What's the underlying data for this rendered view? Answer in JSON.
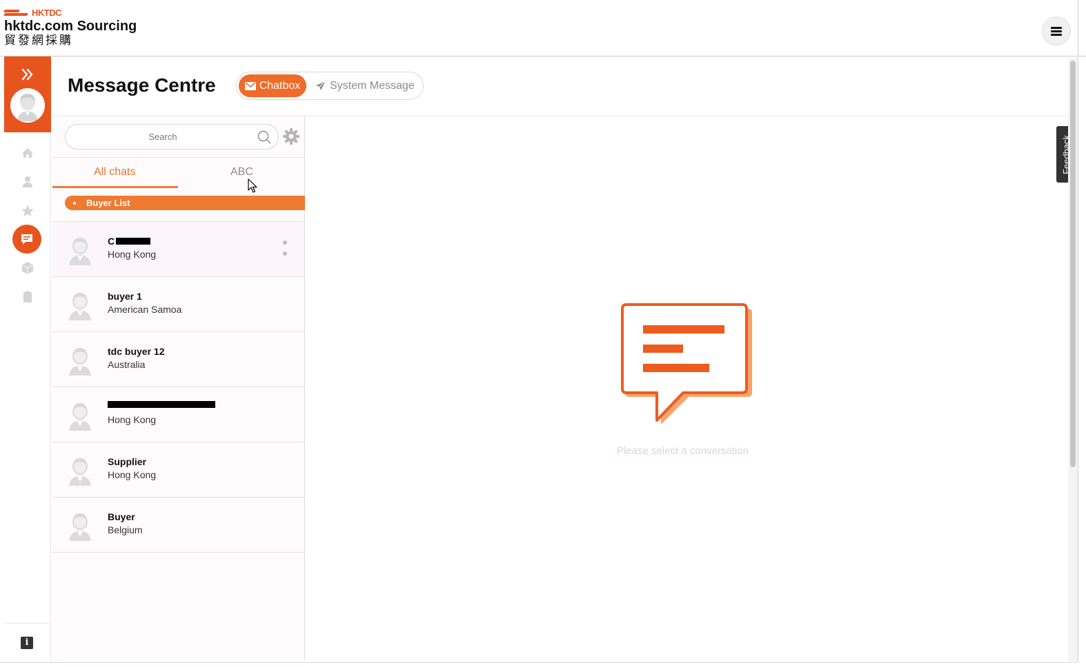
{
  "header": {
    "brand_mark": "HKTDC",
    "site_title": "hktdc.com Sourcing",
    "site_title_cn": "貿發網採購",
    "menu_icon": "hamburger-icon"
  },
  "rail": {
    "items": [
      {
        "name": "home",
        "icon": "home-icon"
      },
      {
        "name": "profile",
        "icon": "person-icon"
      },
      {
        "name": "favourites",
        "icon": "star-icon"
      },
      {
        "name": "messages",
        "icon": "chat-icon",
        "active": true
      },
      {
        "name": "products",
        "icon": "box-icon"
      },
      {
        "name": "orders",
        "icon": "clipboard-icon"
      }
    ],
    "info_label": "i"
  },
  "page": {
    "title": "Message Centre",
    "toggle": {
      "active_label": "Chatbox",
      "other_label": "System Message"
    }
  },
  "chat_list": {
    "search_placeholder": "Search",
    "tabs": [
      "All chats",
      "ABC"
    ],
    "active_tab": "All chats",
    "group_label": "Buyer List",
    "rows": [
      {
        "name": "C",
        "location": "Hong Kong"
      },
      {
        "name": "buyer 1",
        "location": "American Samoa"
      },
      {
        "name": "tdc buyer 12",
        "location": "Australia"
      },
      {
        "name": "",
        "location": "Hong Kong"
      },
      {
        "name": "Supplier",
        "location": "Hong Kong"
      },
      {
        "name": "Buyer",
        "location": "Belgium"
      }
    ]
  },
  "empty_state": {
    "message": "Please select a conversation"
  },
  "feedback_label": "Feedback",
  "colors": {
    "accent": "#e8541e",
    "accent_light": "#f07a30",
    "muted_text": "#8a8a8a"
  }
}
